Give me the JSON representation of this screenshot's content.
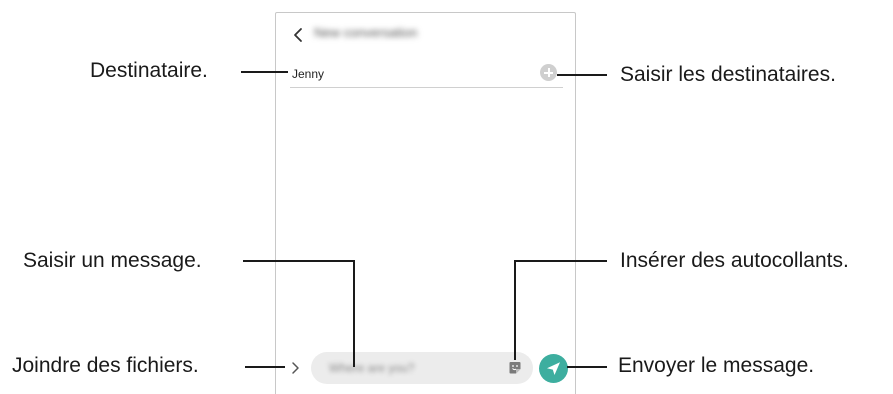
{
  "screen": {
    "header_title": "New conversation",
    "recipient": "Jenny",
    "message_placeholder": "Where are you?"
  },
  "icons": {
    "back": "chevron-left-icon",
    "add_recipient": "plus-circle-icon",
    "expand": "chevron-right-icon",
    "sticker": "sticker-icon",
    "send": "send-icon"
  },
  "colors": {
    "send_button": "#3dae9f",
    "input_background": "#ececec"
  },
  "callouts": {
    "recipient": "Destinataire.",
    "enter_recipients": "Saisir les destinataires.",
    "enter_message": "Saisir un message.",
    "insert_stickers": "Insérer des autocollants.",
    "attach_files": "Joindre des fichiers.",
    "send_message": "Envoyer le message."
  }
}
